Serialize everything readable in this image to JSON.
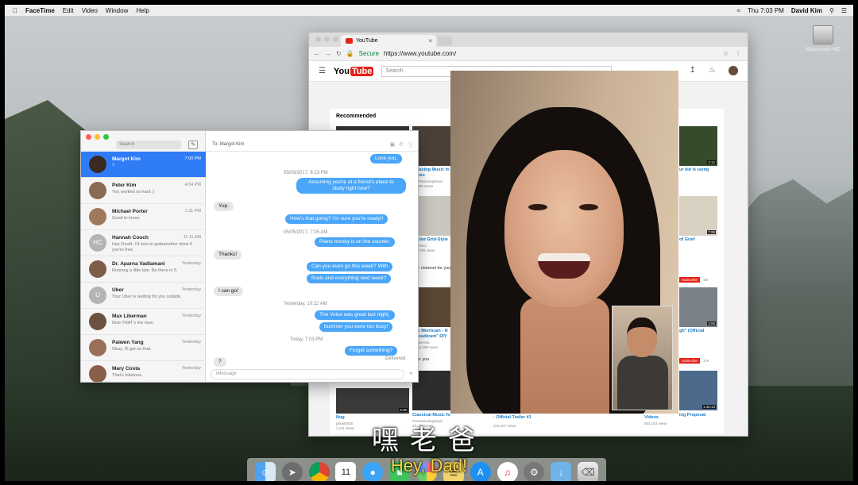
{
  "menubar": {
    "apple": "",
    "app": "FaceTime",
    "items": [
      "Edit",
      "Video",
      "Window",
      "Help"
    ],
    "clock": "Thu 7:03 PM",
    "user": "David Kim"
  },
  "desktop": {
    "drive_label": "Macintosh HD"
  },
  "chrome": {
    "tab_title": "YouTube",
    "secure_label": "Secure",
    "url": "https://www.youtube.com/",
    "search_placeholder": "Search",
    "section": "Recommended",
    "videos": [
      {
        "title": "Relaxing Music fo",
        "title2": "Times",
        "meta": "PureRelaxingMusic",
        "meta2": "23,888 views"
      },
      {
        "title": "Solder Grid-Style",
        "title2": "",
        "meta": "SRPiano",
        "meta2": "271,788 views"
      },
      {
        "title": "The Merricam - N",
        "title2": "\"Steadicam\" DIY",
        "meta": "MBMerrick",
        "meta2": "3,151,289 views"
      },
      {
        "title": "Classical Music fo",
        "title2": "",
        "meta": "PureRelaxingMusic",
        "meta2": "40,237 views"
      },
      {
        "title": "Nug",
        "title2": "",
        "meta": "pmatt0045",
        "meta2": "1,111 views"
      },
      {
        "title": "- Official Trailer #1",
        "title2": "",
        "meta": "",
        "meta2": "203,197 views"
      },
      {
        "title": "ur kid is using",
        "title2": "",
        "meta": "",
        "meta2": ""
      },
      {
        "title": "of Grief",
        "title2": "",
        "meta": "",
        "meta2": ""
      },
      {
        "title": "gh\" (Official",
        "title2": "",
        "meta": "",
        "meta2": ""
      },
      {
        "title": "Videos",
        "title2": "",
        "meta": "",
        "meta2": "503,153 views"
      },
      {
        "title": "ing Proposal",
        "title2": "",
        "meta": "",
        "meta2": ""
      }
    ],
    "durations": [
      "3:12",
      "7:28",
      "4:06",
      "1:45:13",
      "6:36"
    ],
    "subscribe": "Subscribe",
    "subscribe_counts": [
      "1M",
      "17K"
    ],
    "channel_text": "heir channel for you",
    "for_you": "d for you"
  },
  "messages": {
    "search_placeholder": "Search",
    "to_label": "To:",
    "to_name": "Margot Kim",
    "input_placeholder": "iMessage",
    "delivered": "Delivered",
    "conversations": [
      {
        "name": "Margot Kim",
        "time": "7:00 PM",
        "preview": "?",
        "initials": ""
      },
      {
        "name": "Peter Kim",
        "time": "4:04 PM",
        "preview": "You worked so hard ;)",
        "initials": ""
      },
      {
        "name": "Michael Porter",
        "time": "1:31 PM",
        "preview": "Good to know.",
        "initials": ""
      },
      {
        "name": "Hannah Couch",
        "time": "11:11 AM",
        "preview": "Hey David, I'd love to grabanother drink if you're free.",
        "initials": "HC"
      },
      {
        "name": "Dr. Aparna Vadlamani",
        "time": "Yesterday",
        "preview": "Running a little late. Be there in 5.",
        "initials": ""
      },
      {
        "name": "Uber",
        "time": "Yesterday",
        "preview": "Your Uber is waiting for you outside.",
        "initials": "U"
      },
      {
        "name": "Max Liberman",
        "time": "Yesterday",
        "preview": "Now THAT's the max.",
        "initials": ""
      },
      {
        "name": "Paiwen Yang",
        "time": "Yesterday",
        "preview": "Okay, I'll get on that.",
        "initials": ""
      },
      {
        "name": "Mary Costa",
        "time": "Yesterday",
        "preview": "That's hilarious.",
        "initials": ""
      }
    ],
    "thread": {
      "love_you": "Love you.",
      "stamp1": "05/03/2017, 8:23 PM",
      "assuming_1": "Assuming you're at a friend's place to",
      "assuming_2": "study right now?",
      "yup": "Yup.",
      "hows_that": "How's that going? I'm sure you're ready!!",
      "stamp2": "05/05/2017, 7:05 AM",
      "piano": "Piano money is on the counter.",
      "thanks": "Thanks!",
      "can_you": "Can you even go this week? With",
      "finals": "finals and everything next week?",
      "i_can_go": "I can go!",
      "stamp3": "Yesterday, 10:22 AM",
      "voice": "The Voice was great last night,",
      "bummer": "bummer you were too busy!",
      "stamp4": "Today, 7:03 PM",
      "forget": "Forget something?",
      "question": "?"
    }
  },
  "subtitles": {
    "chinese": "嘿老爸",
    "english": "Hey, Dad!"
  },
  "dock": [
    "finder-icon",
    "launchpad-icon",
    "chrome-icon",
    "calendar-icon",
    "messages-icon",
    "facetime-icon",
    "photos-icon",
    "notes-icon",
    "appstore-icon",
    "itunes-icon",
    "system-preferences-icon",
    "downloads-folder-icon",
    "trash-icon"
  ],
  "dock_calendar_day": "11"
}
